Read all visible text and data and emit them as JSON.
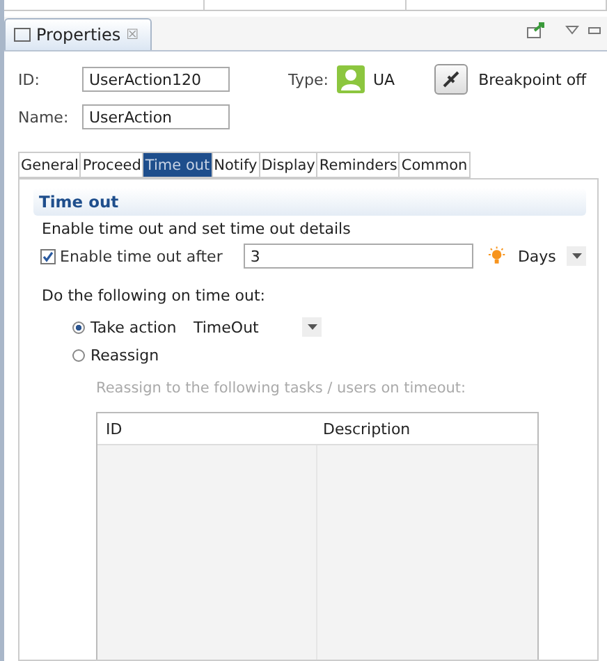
{
  "view_tab": {
    "title": "Properties",
    "close": "☒"
  },
  "id_field": {
    "label": "ID:",
    "value": "UserAction120"
  },
  "type": {
    "label": "Type:",
    "value": "UA"
  },
  "breakpoint": {
    "label": "Breakpoint off"
  },
  "name_field": {
    "label": "Name:",
    "value": "UserAction"
  },
  "tabs": [
    {
      "label": "General",
      "selected": false
    },
    {
      "label": "Proceed",
      "selected": false
    },
    {
      "label": "Time out",
      "selected": true
    },
    {
      "label": "Notify",
      "selected": false
    },
    {
      "label": "Display",
      "selected": false
    },
    {
      "label": "Reminders",
      "selected": false
    },
    {
      "label": "Common",
      "selected": false
    }
  ],
  "section": {
    "title": "Time out",
    "description": "Enable time out and set time out details"
  },
  "enable": {
    "label": "Enable time out after",
    "checked": true,
    "value": "3",
    "unit": "Days"
  },
  "action_heading": "Do the following on time out:",
  "options": [
    {
      "label": "Take action",
      "selected": true,
      "value": "TimeOut"
    },
    {
      "label": "Reassign",
      "selected": false
    }
  ],
  "reassign_hint": "Reassign to the following tasks / users on timeout:",
  "table": {
    "columns": [
      "ID",
      "Description"
    ]
  }
}
